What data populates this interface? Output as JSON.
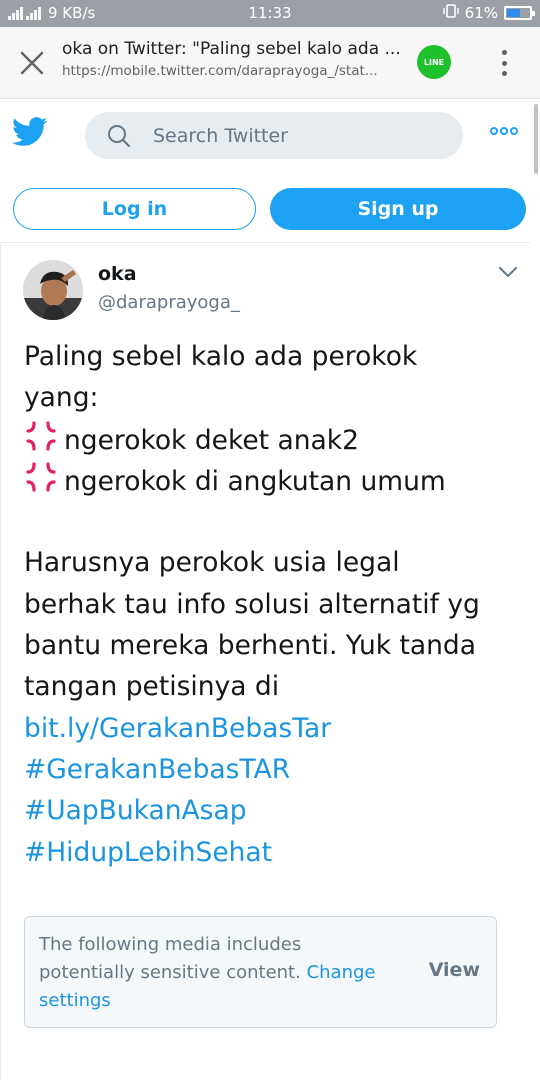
{
  "status_bar": {
    "network_speed": "9 KB/s",
    "time": "11:33",
    "battery": "61%",
    "battery_level": 0.61
  },
  "browser": {
    "page_title": "oka on Twitter: \"Paling sebel kalo ada ...",
    "url": "https://mobile.twitter.com/daraprayoga_/stat...",
    "line_label": "LINE"
  },
  "header": {
    "search_placeholder": "Search Twitter",
    "login_label": "Log in",
    "signup_label": "Sign up"
  },
  "tweet": {
    "author_name": "oka",
    "author_handle": "@daraprayoga_",
    "line1": "Paling sebel kalo ada perokok",
    "line2": "yang:",
    "bullet1": "ngerokok deket anak2",
    "bullet2": "ngerokok di angkutan umum",
    "para2_line1": "Harusnya perokok usia legal",
    "para2_line2": "berhak tau info solusi alternatif yg",
    "para2_line3": "bantu mereka berhenti. Yuk tanda",
    "para2_line4": "tangan petisinya di",
    "link": "bit.ly/GerakanBebasTar",
    "hashtags": [
      "#GerakanBebasTAR",
      "#UapBukanAsap",
      "#HidupLebihSehat"
    ],
    "bullet_icon": "anger-symbol-icon",
    "sensitive_line1": "The following media includes",
    "sensitive_line2": "potentially sensitive content.",
    "sensitive_change": "Change",
    "sensitive_settings": "settings",
    "sensitive_view": "View"
  },
  "colors": {
    "twitter_blue": "#1da1f2",
    "link_blue": "#1b95e0",
    "gray_text": "#657786"
  }
}
